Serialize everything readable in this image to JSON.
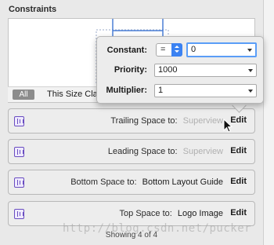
{
  "section_title": "Constraints",
  "filter": {
    "all_label": "All",
    "size_class_label": "This Size Class"
  },
  "popover": {
    "constant_label": "Constant:",
    "relation_value": "=",
    "constant_value": "0",
    "priority_label": "Priority:",
    "priority_value": "1000",
    "multiplier_label": "Multiplier:",
    "multiplier_value": "1"
  },
  "rows": [
    {
      "label": "Trailing Space to:",
      "value": "Superview",
      "muted": true,
      "edit": "Edit"
    },
    {
      "label": "Leading Space to:",
      "value": "Superview",
      "muted": true,
      "edit": "Edit"
    },
    {
      "label": "Bottom Space to:",
      "value": "Bottom Layout Guide",
      "muted": false,
      "edit": "Edit"
    },
    {
      "label": "Top Space to:",
      "value": "Logo Image",
      "muted": false,
      "edit": "Edit"
    }
  ],
  "footer": "Showing 4 of 4",
  "watermark": "http://blog.csdn.net/pucker",
  "colors": {
    "accent": "#3b82f2",
    "constraint_line": "#4a7fd6",
    "icon_purple": "#6a4dc0"
  }
}
